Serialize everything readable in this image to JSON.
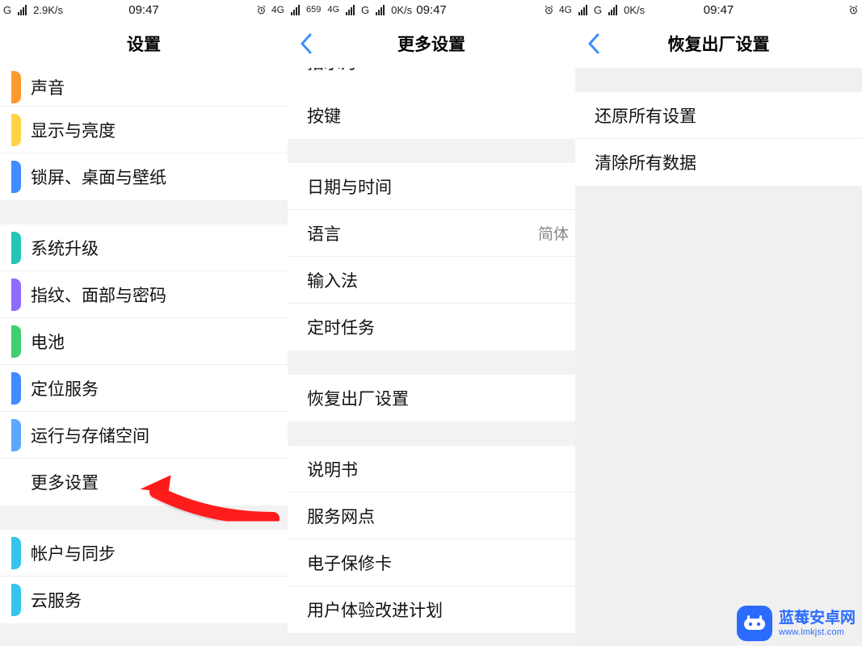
{
  "panel1": {
    "status": {
      "net": "G",
      "speed": "2.9K/s",
      "time": "09:47",
      "alarm": true,
      "right": "4G"
    },
    "title": "设置",
    "sections": [
      {
        "items": [
          {
            "label": "声音",
            "color": "c-orange"
          },
          {
            "label": "显示与亮度",
            "color": "c-yellow"
          },
          {
            "label": "锁屏、桌面与壁纸",
            "color": "c-blue"
          }
        ]
      },
      {
        "items": [
          {
            "label": "系统升级",
            "color": "c-teal"
          },
          {
            "label": "指纹、面部与密码",
            "color": "c-purple"
          },
          {
            "label": "电池",
            "color": "c-green"
          },
          {
            "label": "定位服务",
            "color": "c-blue"
          },
          {
            "label": "运行与存储空间",
            "color": "c-lblue"
          },
          {
            "label": "更多设置",
            "color": ""
          }
        ]
      },
      {
        "items": [
          {
            "label": "帐户与同步",
            "color": "c-cyan"
          },
          {
            "label": "云服务",
            "color": "c-cyan"
          }
        ]
      }
    ]
  },
  "panel2": {
    "status": {
      "left_4g": "4G",
      "num": "659",
      "net": "G",
      "speed": "0K/s",
      "time": "09:47",
      "alarm": true,
      "right": "4G"
    },
    "title": "更多设置",
    "partial_top": "指示灯",
    "items_group1": [
      {
        "label": "按键"
      }
    ],
    "items_group2": [
      {
        "label": "日期与时间"
      },
      {
        "label": "语言",
        "sub": "简体"
      },
      {
        "label": "输入法"
      },
      {
        "label": "定时任务"
      }
    ],
    "items_group3": [
      {
        "label": "恢复出厂设置"
      }
    ],
    "items_group4": [
      {
        "label": "说明书"
      },
      {
        "label": "服务网点"
      },
      {
        "label": "电子保修卡"
      },
      {
        "label": "用户体验改进计划"
      }
    ]
  },
  "panel3": {
    "status": {
      "net": "G",
      "speed": "0K/s",
      "time": "09:47",
      "alarm": true
    },
    "title": "恢复出厂设置",
    "items": [
      {
        "label": "还原所有设置"
      },
      {
        "label": "清除所有数据"
      }
    ]
  },
  "watermark": {
    "line1": "蓝莓安卓网",
    "line2": "www.lmkjst.com"
  }
}
